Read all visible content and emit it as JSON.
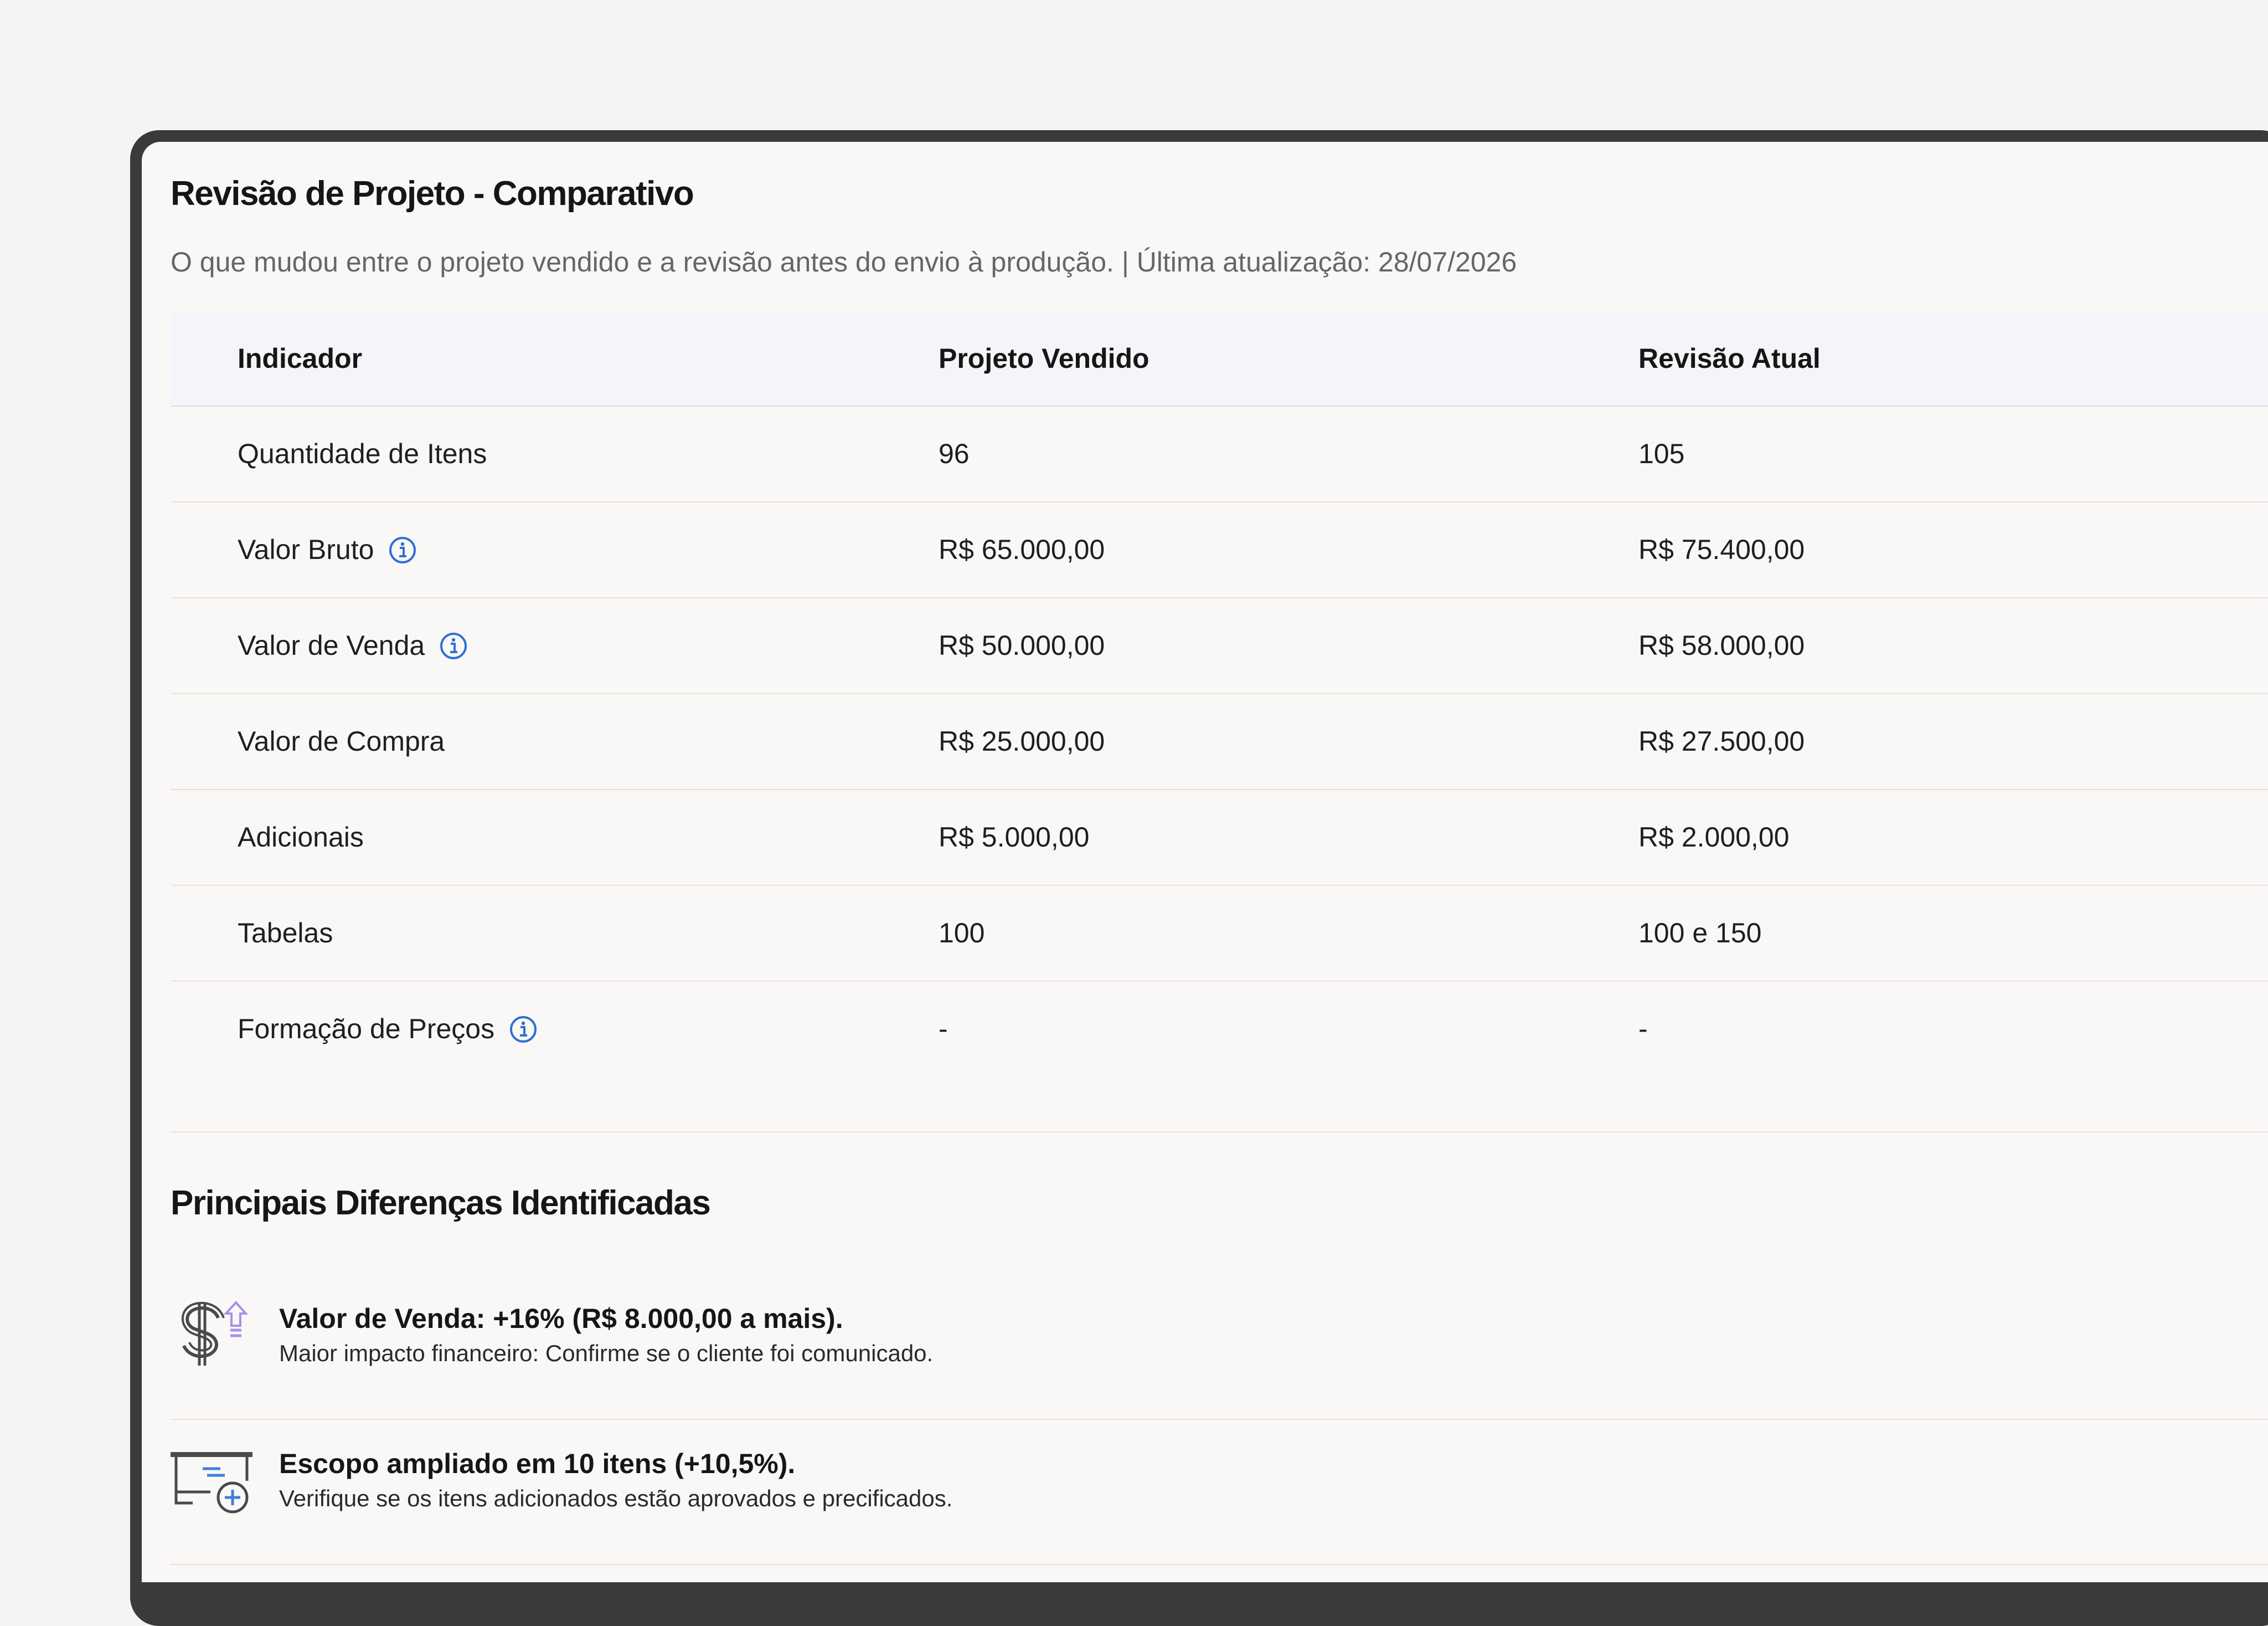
{
  "header": {
    "title": "Revisão de Projeto - Comparativo",
    "subtitle": "O que mudou entre o projeto vendido e a revisão antes do envio à produção. | Última atualização: 28/07/2026"
  },
  "table": {
    "columns": [
      "Indicador",
      "Projeto Vendido",
      "Revisão Atual"
    ],
    "rows": [
      {
        "label": "Quantidade de Itens",
        "sold": "96",
        "current": "105",
        "info": false
      },
      {
        "label": "Valor Bruto",
        "sold": "R$ 65.000,00",
        "current": "R$ 75.400,00",
        "info": true
      },
      {
        "label": "Valor de Venda",
        "sold": "R$ 50.000,00",
        "current": "R$ 58.000,00",
        "info": true
      },
      {
        "label": "Valor de Compra",
        "sold": "R$ 25.000,00",
        "current": "R$ 27.500,00",
        "info": false
      },
      {
        "label": "Adicionais",
        "sold": "R$ 5.000,00",
        "current": "R$ 2.000,00",
        "info": false
      },
      {
        "label": "Tabelas",
        "sold": "100",
        "current": "100 e 150",
        "info": false
      },
      {
        "label": "Formação de Preços",
        "sold": "-",
        "current": "-",
        "info": true
      }
    ]
  },
  "differences": {
    "title": "Principais Diferenças Identificadas",
    "items": [
      {
        "icon": "dollar-up-icon",
        "headline": "Valor de Venda: +16% (R$ 8.000,00 a mais).",
        "detail": "Maior impacto financeiro: Confirme se o cliente foi comunicado."
      },
      {
        "icon": "add-items-icon",
        "headline": "Escopo ampliado em 10 itens (+10,5%).",
        "detail": "Verifique se os itens adicionados estão aprovados e precificados."
      }
    ]
  },
  "colors": {
    "info_icon": "#2f6fd6",
    "accent_purple": "#a592e8",
    "accent_blue": "#3f7ed8"
  }
}
